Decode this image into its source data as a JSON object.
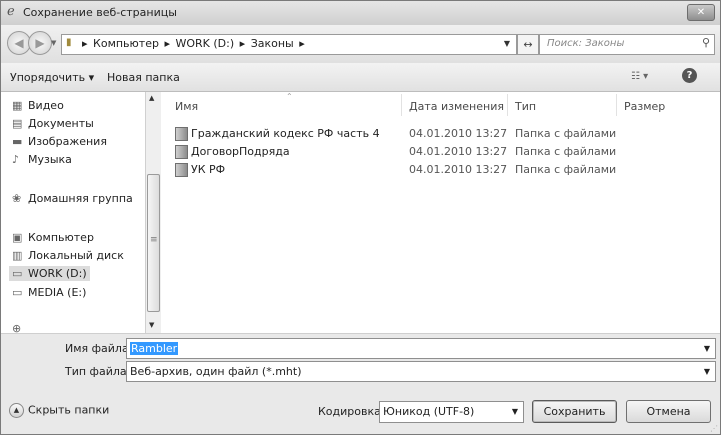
{
  "window": {
    "title": "Сохранение веб-страницы",
    "close_label": "✕"
  },
  "nav": {
    "breadcrumb": [
      "Компьютер",
      "WORK (D:)",
      "Законы"
    ],
    "search_placeholder": "Поиск: Законы"
  },
  "toolbar": {
    "organize_label": "Упорядочить ▾",
    "new_folder_label": "Новая папка"
  },
  "sidebar": {
    "items": [
      {
        "label": "Видео",
        "icon": "video-library-icon"
      },
      {
        "label": "Документы",
        "icon": "documents-icon"
      },
      {
        "label": "Изображения",
        "icon": "pictures-icon"
      },
      {
        "label": "Музыка",
        "icon": "music-icon"
      },
      {
        "label": "Домашняя группа",
        "icon": "homegroup-icon"
      },
      {
        "label": "Компьютер",
        "icon": "computer-icon"
      },
      {
        "label": "Локальный диск",
        "icon": "local-disk-icon"
      },
      {
        "label": "WORK (D:)",
        "icon": "drive-icon",
        "selected": true
      },
      {
        "label": "MEDIA (E:)",
        "icon": "drive-icon"
      }
    ]
  },
  "columns": {
    "name": "Имя",
    "date": "Дата изменения",
    "type": "Тип",
    "size": "Размер"
  },
  "files": [
    {
      "name": "Гражданский кодекс РФ часть 4",
      "date": "04.01.2010 13:27",
      "type": "Папка с файлами"
    },
    {
      "name": "ДоговорПодряда",
      "date": "04.01.2010 13:27",
      "type": "Папка с файлами"
    },
    {
      "name": "УК РФ",
      "date": "04.01.2010 13:27",
      "type": "Папка с файлами"
    }
  ],
  "form": {
    "filename_label": "Имя файла:",
    "filename_value": "Rambler",
    "filetype_label": "Тип файла:",
    "filetype_value": "Веб-архив, один файл  (*.mht)",
    "encoding_label": "Кодировка:",
    "encoding_value": "Юникод (UTF-8)"
  },
  "buttons": {
    "hide_folders": "Скрыть папки",
    "save": "Сохранить",
    "cancel": "Отмена"
  },
  "colors": {
    "selection": "#3399ff",
    "window_bg": "#e9e9e9"
  }
}
